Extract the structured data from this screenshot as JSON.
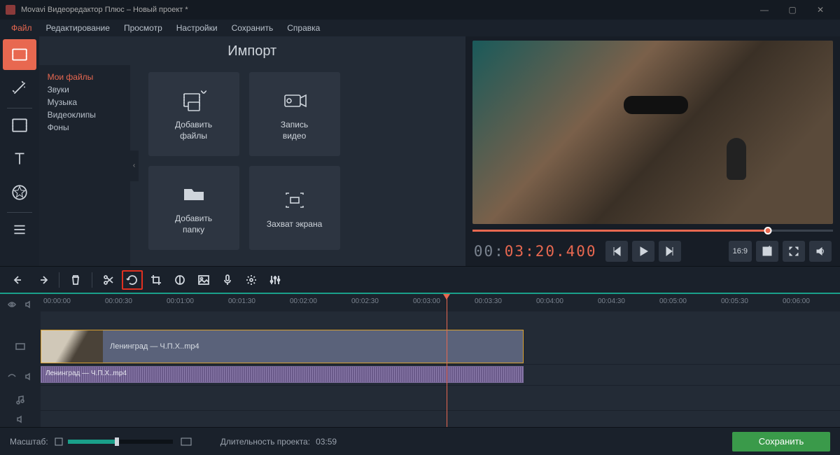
{
  "window": {
    "title": "Movavi Видеоредактор Плюс – Новый проект *"
  },
  "menu": {
    "items": [
      "Файл",
      "Редактирование",
      "Просмотр",
      "Настройки",
      "Сохранить",
      "Справка"
    ]
  },
  "rail": {
    "items": [
      "import",
      "magic",
      "filters",
      "titles",
      "stickers",
      "list"
    ],
    "active": 0
  },
  "import": {
    "heading": "Импорт",
    "sources": [
      "Мои файлы",
      "Звуки",
      "Музыка",
      "Видеоклипы",
      "Фоны"
    ],
    "active_source": 0,
    "tiles": [
      {
        "icon": "media-add",
        "label": "Добавить\nфайлы"
      },
      {
        "icon": "camera",
        "label": "Запись\nвидео"
      },
      {
        "icon": "folder-add",
        "label": "Добавить\nпапку"
      },
      {
        "icon": "capture",
        "label": "Захват экрана"
      }
    ]
  },
  "preview": {
    "progress": 0.82,
    "timecode_pre": "00:",
    "timecode_main": "03:20.400",
    "aspect": "16:9"
  },
  "toolbar": {
    "highlight": "rotate"
  },
  "ruler": [
    "00:00:00",
    "00:00:30",
    "00:01:00",
    "00:01:30",
    "00:02:00",
    "00:02:30",
    "00:03:00",
    "00:03:30",
    "00:04:00",
    "00:04:30",
    "00:05:00",
    "00:05:30",
    "00:06:00"
  ],
  "clips": {
    "video": {
      "name": "Ленинград — Ч.П.Х..mp4"
    },
    "audio": {
      "name": "Ленинград — Ч.П.Х..mp4"
    }
  },
  "status": {
    "zoom_label": "Масштаб:",
    "duration_label": "Длительность проекта:",
    "duration_value": "03:59",
    "save": "Сохранить"
  }
}
